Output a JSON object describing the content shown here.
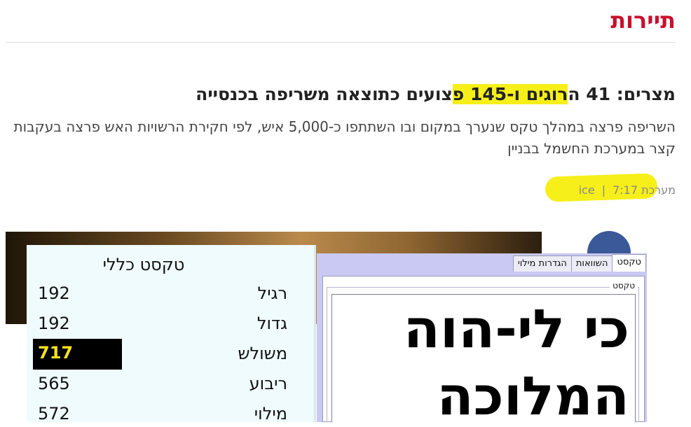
{
  "section": {
    "title": "תיירות"
  },
  "article": {
    "headline_before": "מצרים: 41 ה",
    "headline_highlight": "רוגים ו-145 פ",
    "headline_after": "צועים כתוצאה משריפה בכנסייה",
    "subtitle": "השריפה פרצה במהלך טקס שנערך במקום ובו השתתפו כ-5,000 איש, לפי חקירת הרשויות האש פרצה בעקבות קצר במערכת החשמל בבניין",
    "byline_author": "מערכת ice",
    "byline_separator": "|",
    "byline_time": "7:17",
    "highlight_color": "#f6ef19"
  },
  "gematria": {
    "title": "טקסט כללי",
    "rows": [
      {
        "label": "רגיל",
        "value": "192"
      },
      {
        "label": "גדול",
        "value": "192"
      },
      {
        "label": "משולש",
        "value": "717",
        "highlighted": true
      },
      {
        "label": "ריבוע",
        "value": "565"
      },
      {
        "label": "מילוי",
        "value": "572"
      }
    ]
  },
  "editor": {
    "tabs": [
      "טקסט",
      "השוואות",
      "הגדרות מילוי"
    ],
    "active_tab": "טקסט",
    "group_label": "טקסט",
    "text_line1": "כי לי-הוה",
    "text_line2": "המלוכה"
  },
  "colors": {
    "section_title": "#c8102e",
    "window_bg": "#c9c9f3",
    "panel_bg": "#f0fbfd",
    "value_highlight": "#f8e11e"
  },
  "icons": {
    "social": "facebook-icon"
  }
}
